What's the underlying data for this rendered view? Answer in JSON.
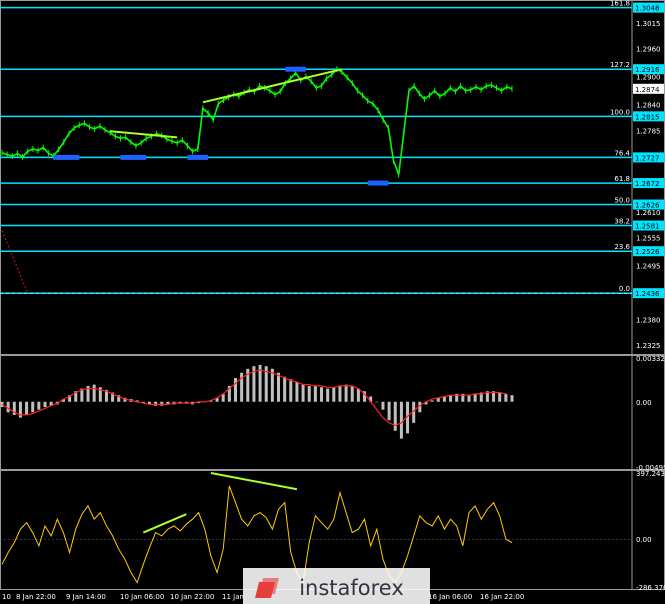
{
  "chart_data": [
    {
      "type": "line",
      "panel": "price",
      "price_axis_labels": [
        "1.3048",
        "1.3015",
        "1.2960",
        "1.2916",
        "1.2900",
        "1.2874",
        "1.2840",
        "1.2815",
        "1.2785",
        "1.2727",
        "1.2672",
        "1.2626",
        "1.2610",
        "1.2581",
        "1.2555",
        "1.2526",
        "1.2495",
        "1.2436",
        "1.2380",
        "1.2325"
      ],
      "current_price": "1.2874",
      "levels": [
        {
          "label": "161.8",
          "price": 1.3048,
          "box": "1.3048"
        },
        {
          "label": "127.2",
          "price": 1.2916,
          "box": "1.2916"
        },
        {
          "label": "100.0",
          "price": 1.2815,
          "box": "1.2815"
        },
        {
          "label": "76.4",
          "price": 1.2727,
          "box": "1.2727"
        },
        {
          "label": "61.8",
          "price": 1.2672,
          "box": "1.2672"
        },
        {
          "label": "50.0",
          "price": 1.2626,
          "box": "1.2626"
        },
        {
          "label": "38.2",
          "price": 1.2581,
          "box": "1.2581"
        },
        {
          "label": "23.6",
          "price": 1.2526,
          "box": "1.2526"
        },
        {
          "label": "0.0",
          "price": 1.2436,
          "box": "1.2436"
        }
      ],
      "ylim": [
        1.231,
        1.306
      ],
      "line_color": "#00ff00",
      "level_color": "#00e5ff",
      "series": [
        {
          "values": [
            1.2737,
            1.2733,
            1.273,
            1.2735,
            1.2728,
            1.274,
            1.2745,
            1.2742,
            1.2748,
            1.2736,
            1.273,
            1.2744,
            1.276,
            1.2778,
            1.279,
            1.2796,
            1.28,
            1.2792,
            1.2788,
            1.2794,
            1.2786,
            1.278,
            1.2772,
            1.2768,
            1.277,
            1.276,
            1.2752,
            1.2758,
            1.2768,
            1.2772,
            1.2778,
            1.2774,
            1.2766,
            1.2762,
            1.2758,
            1.2764,
            1.2752,
            1.274,
            1.2745,
            1.2832,
            1.2822,
            1.2808,
            1.2842,
            1.285,
            1.2856,
            1.2862,
            1.2858,
            1.2866,
            1.2872,
            1.2868,
            1.288,
            1.2876,
            1.287,
            1.2862,
            1.2868,
            1.2886,
            1.2896,
            1.2908,
            1.2892,
            1.29,
            1.289,
            1.2876,
            1.288,
            1.2896,
            1.2904,
            1.2916,
            1.291,
            1.2898,
            1.2886,
            1.287,
            1.286,
            1.2848,
            1.2842,
            1.2828,
            1.2808,
            1.279,
            1.272,
            1.269,
            1.278,
            1.287,
            1.288,
            1.2864,
            1.2852,
            1.286,
            1.287,
            1.2858,
            1.2864,
            1.2876,
            1.2868,
            1.288,
            1.287,
            1.2872,
            1.2878,
            1.2872,
            1.288,
            1.2882,
            1.2876,
            1.287,
            1.2878,
            1.2874
          ]
        }
      ],
      "trend_lines": [
        {
          "from": [
            39,
            1.2845
          ],
          "to": [
            66,
            1.2916
          ]
        },
        {
          "from": [
            21,
            1.2783
          ],
          "to": [
            34,
            1.277
          ]
        }
      ],
      "support_markers": [
        {
          "x1": 10,
          "x2": 15,
          "price": 1.2727
        },
        {
          "x1": 23,
          "x2": 28,
          "price": 1.2727
        },
        {
          "x1": 36,
          "x2": 40,
          "price": 1.2727
        },
        {
          "x1": 55,
          "x2": 59,
          "price": 1.2916
        },
        {
          "x1": 71,
          "x2": 75,
          "price": 1.2672
        }
      ],
      "dashed_lines": [
        {
          "price": 1.2436
        }
      ],
      "red_decline_x": [
        0,
        5
      ],
      "red_decline_y": [
        1.257,
        1.2436
      ]
    },
    {
      "type": "bar",
      "panel": "macd",
      "axis_labels": [
        "0.00332",
        "0.00",
        "-0.00495"
      ],
      "ylim": [
        -0.00495,
        0.00332
      ],
      "histogram": [
        -0.0004,
        -0.0008,
        -0.001,
        -0.0012,
        -0.001,
        -0.0008,
        -0.0006,
        -0.0004,
        -0.0003,
        -0.0002,
        0.0002,
        0.0005,
        0.0008,
        0.001,
        0.0012,
        0.0013,
        0.0011,
        0.0009,
        0.0007,
        0.0005,
        0.0003,
        0.0002,
        0.0001,
        -0.0001,
        -0.0002,
        -0.0003,
        -0.0003,
        -0.0002,
        -0.0002,
        -0.0001,
        -0.0001,
        -0.0002,
        -0.0001,
        0.0,
        0.0001,
        0.0003,
        0.0006,
        0.0012,
        0.0018,
        0.0022,
        0.0025,
        0.0027,
        0.0028,
        0.0027,
        0.0025,
        0.0022,
        0.0019,
        0.0017,
        0.0015,
        0.0013,
        0.0012,
        0.0012,
        0.0011,
        0.001,
        0.0011,
        0.0012,
        0.0013,
        0.0012,
        0.001,
        0.0008,
        0.0004,
        0.0,
        -0.0006,
        -0.0014,
        -0.0022,
        -0.0028,
        -0.0024,
        -0.0016,
        -0.0008,
        -0.0002,
        0.0001,
        0.0003,
        0.0004,
        0.0005,
        0.0006,
        0.0006,
        0.0005,
        0.0006,
        0.0007,
        0.0008,
        0.0008,
        0.0007,
        0.0006,
        0.0005
      ],
      "signal": [
        -0.0002,
        -0.0005,
        -0.0008,
        -0.001,
        -0.001,
        -0.0009,
        -0.0007,
        -0.0005,
        -0.0003,
        -0.0001,
        0.0002,
        0.0004,
        0.0007,
        0.0009,
        0.001,
        0.001,
        0.0009,
        0.0008,
        0.0006,
        0.0004,
        0.0002,
        0.0001,
        0.0,
        -0.0001,
        -0.0002,
        -0.0002,
        -0.0002,
        -0.0002,
        -0.0001,
        -0.0001,
        -0.0001,
        -0.0001,
        0.0,
        0.0,
        0.0001,
        0.0003,
        0.0006,
        0.001,
        0.0014,
        0.0018,
        0.0021,
        0.0023,
        0.0024,
        0.0023,
        0.0022,
        0.002,
        0.0018,
        0.0016,
        0.0015,
        0.0013,
        0.0013,
        0.0012,
        0.0012,
        0.0011,
        0.0011,
        0.0012,
        0.0012,
        0.0012,
        0.001,
        0.0006,
        0.0,
        -0.0006,
        -0.0012,
        -0.0016,
        -0.0018,
        -0.0016,
        -0.0011,
        -0.0007,
        -0.0003,
        0.0,
        0.0002,
        0.0003,
        0.0004,
        0.0005,
        0.0005,
        0.0005,
        0.0005,
        0.0006,
        0.0006,
        0.0007,
        0.0007,
        0.0007,
        0.0006
      ],
      "bar_color": "#c0c0c0",
      "signal_color": "#ff2020"
    },
    {
      "type": "line",
      "panel": "cci",
      "axis_labels": [
        "397.2434",
        "0.00",
        "-286.3763"
      ],
      "ylim": [
        -286.3763,
        397.2434
      ],
      "series": [
        {
          "values": [
            -150,
            -80,
            -20,
            60,
            100,
            40,
            -40,
            80,
            20,
            120,
            40,
            -80,
            60,
            150,
            200,
            120,
            160,
            80,
            20,
            -60,
            -120,
            -200,
            -260,
            -150,
            -50,
            40,
            20,
            60,
            80,
            50,
            90,
            120,
            160,
            60,
            -100,
            -200,
            -60,
            320,
            220,
            120,
            80,
            140,
            160,
            130,
            60,
            180,
            220,
            -80,
            -200,
            -260,
            -20,
            140,
            100,
            60,
            120,
            280,
            160,
            40,
            60,
            120,
            -40,
            60,
            -120,
            -220,
            -260,
            -200,
            -100,
            20,
            140,
            100,
            80,
            140,
            60,
            120,
            80,
            -40,
            160,
            200,
            120,
            180,
            220,
            140,
            0,
            -20
          ]
        }
      ],
      "line_color": "#ffcc00",
      "trend_lines": [
        {
          "from": [
            23,
            40
          ],
          "to": [
            30,
            150
          ]
        },
        {
          "from": [
            34,
            397
          ],
          "to": [
            48,
            300
          ]
        }
      ]
    }
  ],
  "x_axis_labels": [
    "10",
    "8 Jan 22:00",
    "9 Jan 14:00",
    "10 Jan 06:00",
    "10 Jan 22:00",
    "11 Jan",
    "16 Jan 06:00",
    "16 Jan 22:00"
  ],
  "logo_text": "instaforex"
}
